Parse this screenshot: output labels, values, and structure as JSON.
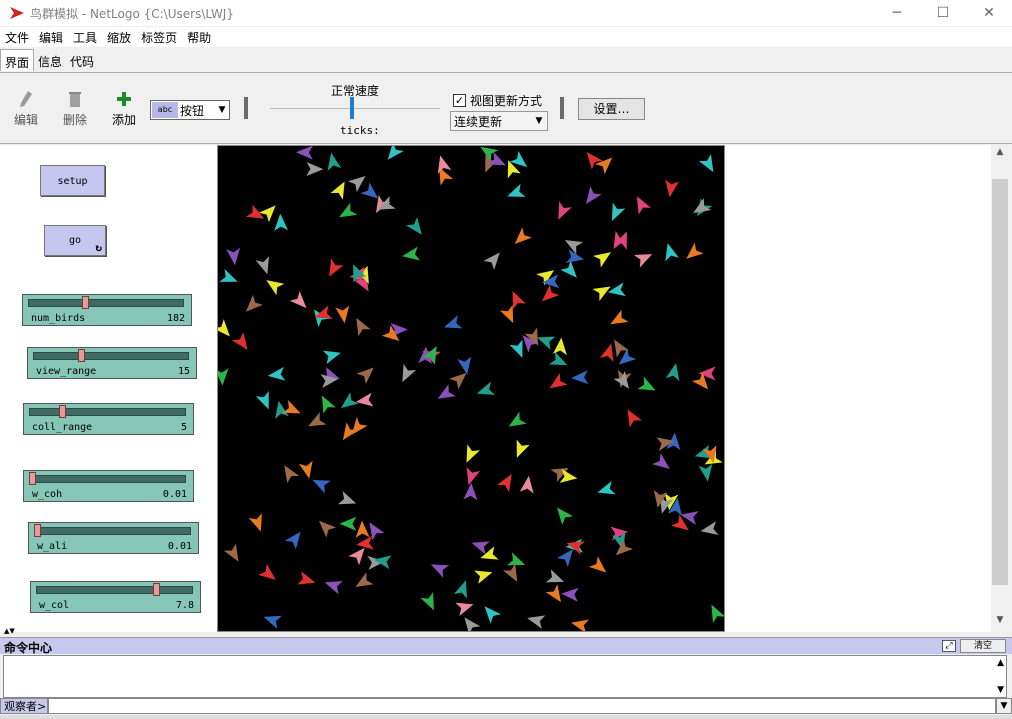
{
  "window": {
    "title": "鸟群模拟 - NetLogo {C:\\Users\\LWJ}",
    "minimize": "─",
    "maximize": "☐",
    "close": "✕",
    "icon": "netlogo-red-arrow-icon"
  },
  "menu": [
    "文件",
    "编辑",
    "工具",
    "缩放",
    "标签页",
    "帮助"
  ],
  "tabs": [
    {
      "label": "界面",
      "active": true
    },
    {
      "label": "信息",
      "active": false
    },
    {
      "label": "代码",
      "active": false
    }
  ],
  "toolbar": {
    "edit_label": "编辑",
    "delete_label": "删除",
    "add_label": "添加",
    "widget_type": "按钮",
    "widget_abc": "abc",
    "speed_label": "正常速度",
    "speed_fraction": 0.48,
    "ticks_label": "ticks:",
    "view_update_label": "视图更新方式",
    "view_update_checked": true,
    "update_mode": "连续更新",
    "settings_label": "设置…"
  },
  "widgets": {
    "setup": {
      "label": "setup"
    },
    "go": {
      "label": "go",
      "forever": true
    },
    "sliders": [
      {
        "name": "num_birds",
        "value": "182",
        "fraction": 0.36
      },
      {
        "name": "view_range",
        "value": "15",
        "fraction": 0.3
      },
      {
        "name": "coll_range",
        "value": "5",
        "fraction": 0.2
      },
      {
        "name": "w_coh",
        "value": "0.01",
        "fraction": 0.0
      },
      {
        "name": "w_ali",
        "value": "0.01",
        "fraction": 0.0
      },
      {
        "name": "w_col",
        "value": "7.8",
        "fraction": 0.78
      }
    ]
  },
  "world": {
    "background": "#000000",
    "turtle_colors": [
      "#2cb34a",
      "#e8e82e",
      "#e0427e",
      "#8a52b8",
      "#2ec4c4",
      "#e87a22",
      "#e88a9a",
      "#3468c0",
      "#1f9f8c",
      "#9a9a9a",
      "#9a6a4a",
      "#e03030"
    ]
  },
  "command_center": {
    "title": "命令中心",
    "clear_label": "清空",
    "observer_label": "观察者>",
    "input_value": ""
  }
}
